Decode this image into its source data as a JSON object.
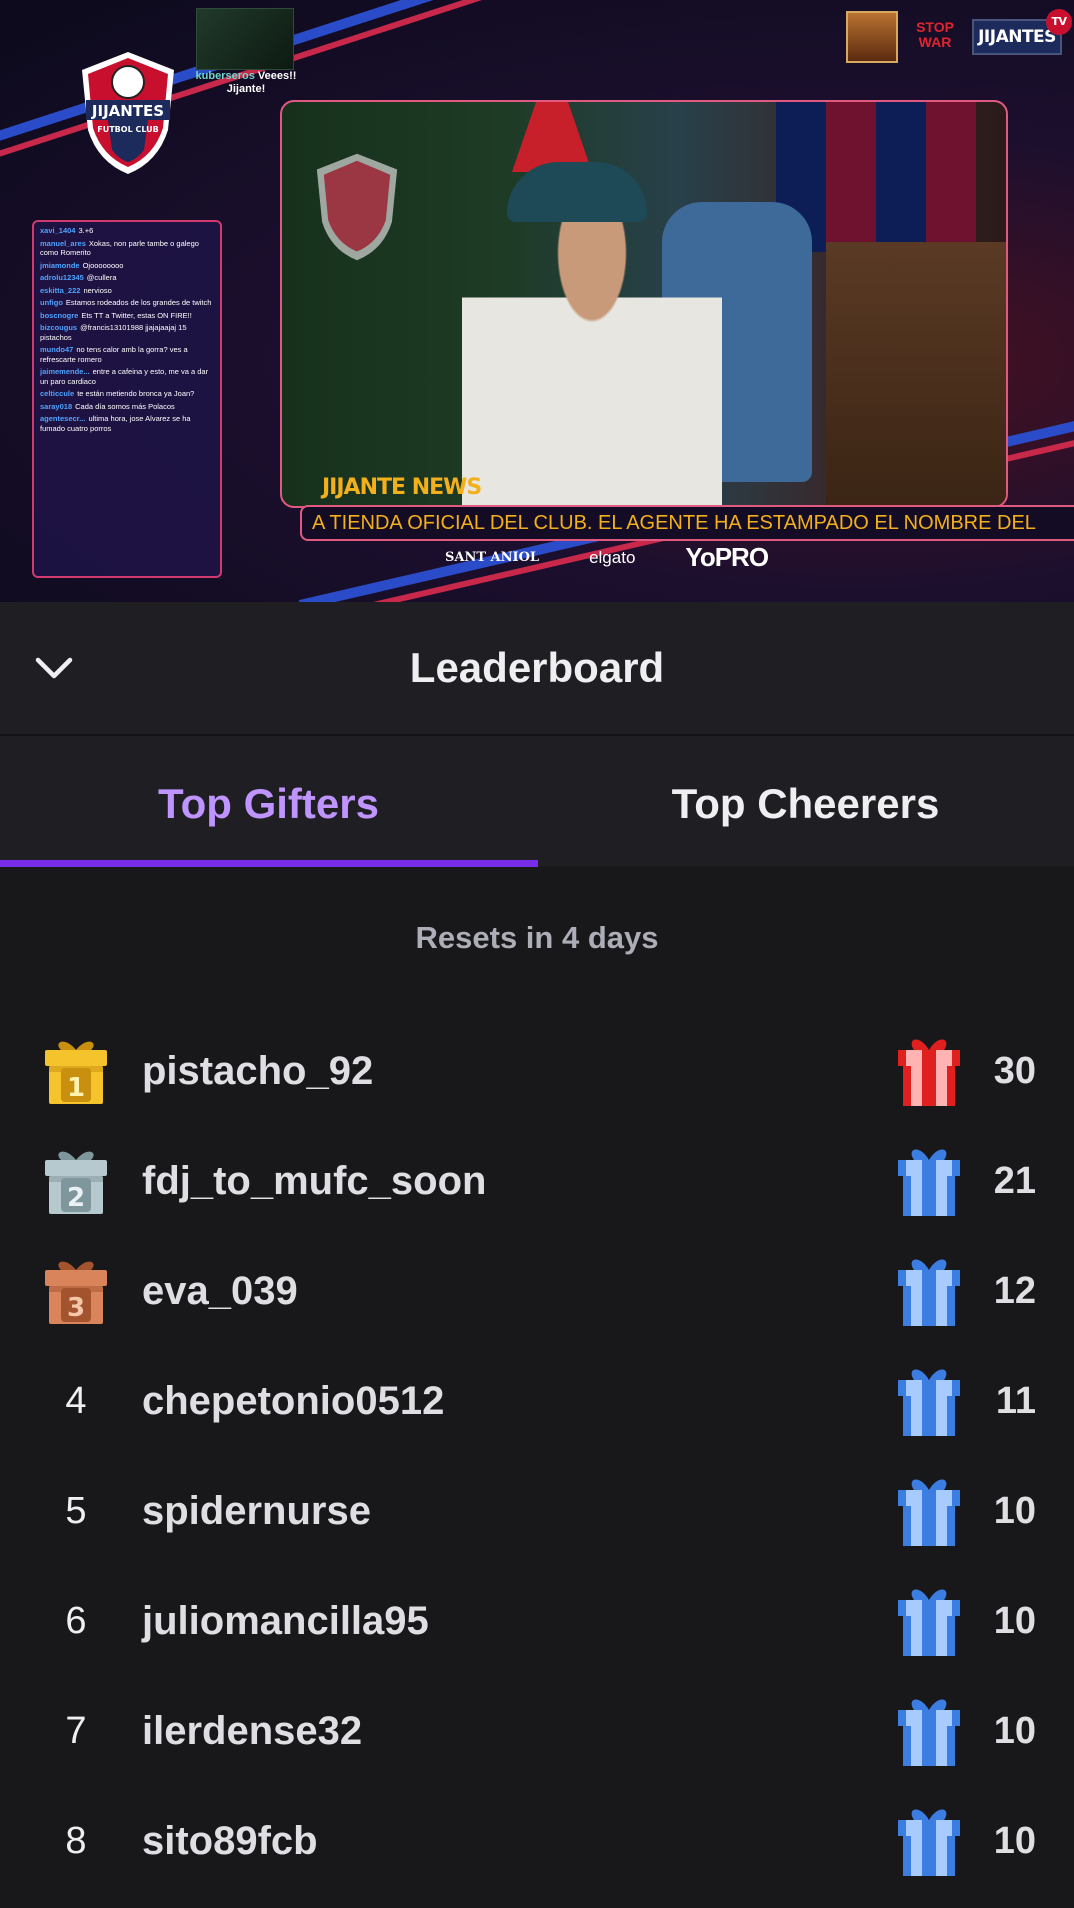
{
  "stream": {
    "webcam_caption_user": "kuberseros",
    "webcam_caption_text": "Veees!! Jijante!",
    "logo_text": "JIJANTES",
    "logo_sub": "FUTBOL CLUB",
    "top_logo_text": "JIJANTES",
    "top_logo_badge": "TV",
    "stop_war_text": "STOP WAR",
    "news_tag": "JIJANTE NEWS",
    "ticker_text": "A TIENDA OFICIAL DEL CLUB. EL AGENTE HA ESTAMPADO EL NOMBRE DEL",
    "sponsors": [
      "SANT ANIOL",
      "elgato",
      "YoPRO"
    ],
    "chat": [
      {
        "user": "xavi_1404",
        "text": "3.+6"
      },
      {
        "user": "manuel_ares",
        "text": "Xokas, non parle tambe o galego como Romerito"
      },
      {
        "user": "jmiamonde",
        "text": "Ojoooooooo"
      },
      {
        "user": "adrolu12345",
        "text": "@cullera"
      },
      {
        "user": "eskitta_222",
        "text": "nervioso"
      },
      {
        "user": "unfigo",
        "text": "Estamos rodeados de los grandes de twitch"
      },
      {
        "user": "boscnogre",
        "text": "Ets TT a Twitter, estas ON FIRE!!"
      },
      {
        "user": "bizcougus",
        "text": "@francis13101988 jjajajaajaj 15 pistachos"
      },
      {
        "user": "mundo47",
        "text": "no tens calor amb la gorra? ves a refrescarte romero"
      },
      {
        "user": "jaimemende...",
        "text": "entre a cafeina y esto, me va a dar un paro cardiaco"
      },
      {
        "user": "celticcule",
        "text": "te están metiendo bronca ya Joan?"
      },
      {
        "user": "saray018",
        "text": "Cada día somos más Polacos"
      },
      {
        "user": "agentesecr...",
        "text": "ultima hora, jose Alvarez se ha fumado cuatro porros"
      }
    ]
  },
  "header": {
    "title": "Leaderboard"
  },
  "tabs": [
    {
      "label": "Top Gifters",
      "active": true
    },
    {
      "label": "Top Cheerers",
      "active": false
    }
  ],
  "resets_text": "Resets in 4 days",
  "colors": {
    "accent": "#772ce8",
    "accent_text": "#bf94ff",
    "gold": "#f5c32c",
    "silver": "#b6c9cf",
    "bronze": "#d9845a",
    "gift_red": "#e01f1f",
    "gift_blue": "#3b7de0"
  },
  "leaderboard": [
    {
      "rank": "1",
      "medal": "gold-gift-icon",
      "username": "pistacho_92",
      "gift_icon": "red-gift-icon",
      "count": "30"
    },
    {
      "rank": "2",
      "medal": "silver-gift-icon",
      "username": "fdj_to_mufc_soon",
      "gift_icon": "blue-gift-icon",
      "count": "21"
    },
    {
      "rank": "3",
      "medal": "bronze-gift-icon",
      "username": "eva_039",
      "gift_icon": "blue-gift-icon",
      "count": "12"
    },
    {
      "rank": "4",
      "medal": "",
      "username": "chepetonio0512",
      "gift_icon": "blue-gift-icon",
      "count": "11"
    },
    {
      "rank": "5",
      "medal": "",
      "username": "spidernurse",
      "gift_icon": "blue-gift-icon",
      "count": "10"
    },
    {
      "rank": "6",
      "medal": "",
      "username": "juliomancilla95",
      "gift_icon": "blue-gift-icon",
      "count": "10"
    },
    {
      "rank": "7",
      "medal": "",
      "username": "ilerdense32",
      "gift_icon": "blue-gift-icon",
      "count": "10"
    },
    {
      "rank": "8",
      "medal": "",
      "username": "sito89fcb",
      "gift_icon": "blue-gift-icon",
      "count": "10"
    }
  ]
}
